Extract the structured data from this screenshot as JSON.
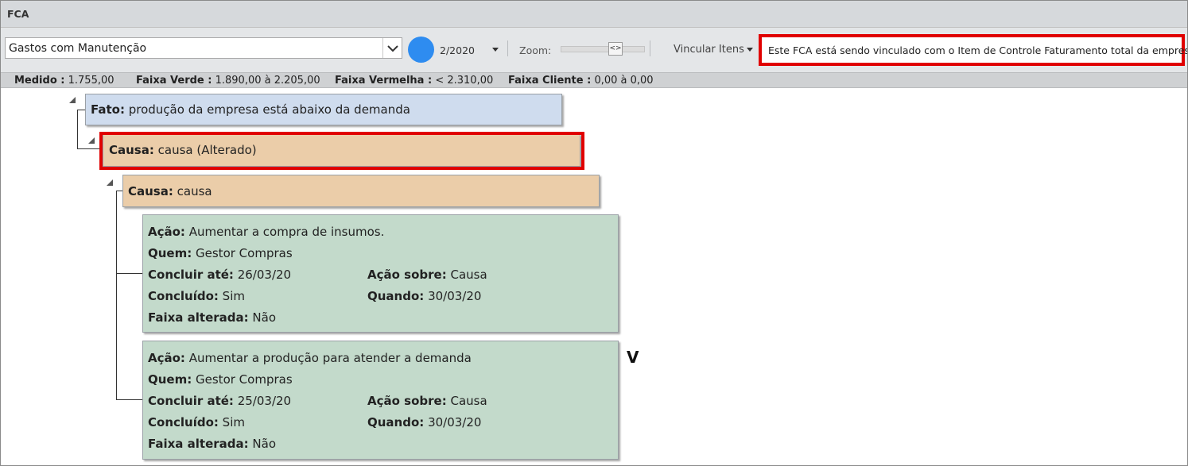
{
  "window": {
    "title": "FCA"
  },
  "toolbar": {
    "indicator_select": "Gastos com Manutenção",
    "period": "2/2020",
    "zoom_label": "Zoom:",
    "zoom_thumb": "<>",
    "link_items_label": "Vincular Itens",
    "link_message": "Este FCA está sendo vinculado com o Item de Controle Faturamento total da empresa",
    "status_color": "#2e8cf0"
  },
  "status": {
    "medido_label": "Medido :",
    "medido_value": "1.755,00",
    "faixa_verde_label": "Faixa Verde :",
    "faixa_verde_value": "1.890,00 à 2.205,00",
    "faixa_vermelha_label": "Faixa Vermelha :",
    "faixa_vermelha_value": "< 2.310,00",
    "faixa_cliente_label": "Faixa Cliente :",
    "faixa_cliente_value": "0,00 à 0,00"
  },
  "tree": {
    "fato": {
      "label": "Fato:",
      "text": "produção da empresa está abaixo da demanda"
    },
    "causa1": {
      "label": "Causa:",
      "text": "causa (Alterado)"
    },
    "causa2": {
      "label": "Causa:",
      "text": "causa"
    },
    "acoes": [
      {
        "acao_label": "Ação:",
        "acao": "Aumentar a compra de insumos.",
        "quem_label": "Quem:",
        "quem": "Gestor Compras",
        "concluir_label": "Concluir até:",
        "concluir": "26/03/20",
        "sobre_label": "Ação sobre:",
        "sobre": "Causa",
        "concluido_label": "Concluído:",
        "concluido": "Sim",
        "quando_label": "Quando:",
        "quando": "30/03/20",
        "faixa_label": "Faixa alterada:",
        "faixa": "Não"
      },
      {
        "acao_label": "Ação:",
        "acao": "Aumentar a produção para atender a demanda",
        "quem_label": "Quem:",
        "quem": "Gestor Compras",
        "concluir_label": "Concluir até:",
        "concluir": "25/03/20",
        "sobre_label": "Ação sobre:",
        "sobre": "Causa",
        "concluido_label": "Concluído:",
        "concluido": "Sim",
        "quando_label": "Quando:",
        "quando": "30/03/20",
        "faixa_label": "Faixa alterada:",
        "faixa": "Não"
      }
    ],
    "mark": "V"
  }
}
